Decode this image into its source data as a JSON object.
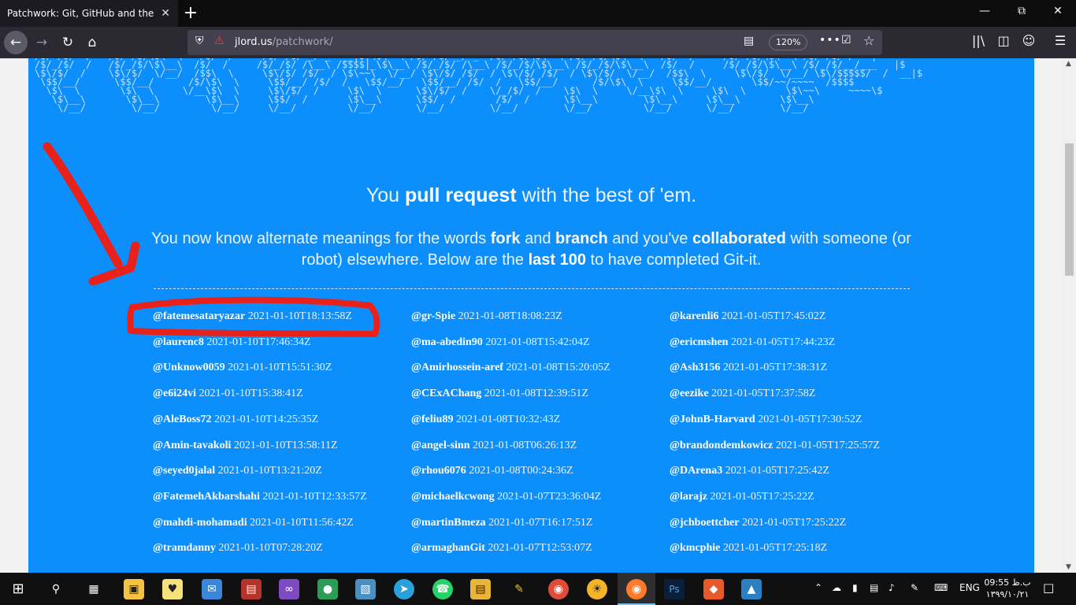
{
  "browser": {
    "tab_title": "Patchwork: Git, GitHub and the Pull",
    "tab_close": "✕",
    "new_tab": "+",
    "url_domain": "jlord.us",
    "url_path": "/patchwork/",
    "zoom": "120%"
  },
  "page": {
    "ascii_art": "/$/ /$/  /   /$/ /$/\\$\\  \\   /$/  /     /$/ /$/ _/ _  __|$|\\$\\  \\ /$/ /$/ _/ _  /$/ /$/\\$\\  \\ /$/ /$/\\$\\  \\   /$/  /     /$/ /$/\\$\\  \\ /$/ /$/ /   |\n/$/_/$/  /   /$/_/$/\\$\\__\\  /$/  /     /$/_/$/ /\\__\\ /$$$$|_\\$\\__\\ /$/_/$/ /\\__\\ /$/_/$/\\$\\__\\ /$/_/$/\\$\\__\\  /$/  /     /$/_/$/\\$\\__\\ /$/_/$/__/___   |$\n\\$\\/$/  /    \\$\\/$/  \\/__/  /$$\\  \\     \\$\\/$/ /$/  / \\$\\~~\\  \\/__/ \\$\\/$/ /$/  / \\$\\/$/ /$/  / \\$\\/$/  \\/__/  /$$\\  \\     \\$\\/$/  \\/__/ \\$\\/$$$$$/  /  __|$\n \\$$/__/      \\$$/__/      /$/\\$\\  \\     \\$$/__/ /$/  /   \\$$/__/   \\$$/__/ /$/  /   \\$$/__/      /$/\\$\\  \\     \\$$/__/       \\$$/~~/~~~~  /$$$$\n  \\$\\  \\       \\$\\  \\     \\/__\\$\\  \\     \\$\\/$/  /     \\$\\  \\      \\$\\/$/  /    \\/_/$/  /    \\$\\  \\     \\/__\\$\\  \\     \\$\\  \\       \\$\\~~\\     ~~~~\\$\n   \\$\\__\\       \\$\\__\\        \\$\\__\\     \\$$/  /       \\$\\__\\      \\$$/  /       /$/  /      \\$\\__\\        \\$\\__\\     \\$\\__\\       \\$\\__\\\n    \\/__/        \\/__/         \\/__/     \\/__/         \\/__/       \\/__/        \\/__/        \\/__/         \\/__/      \\/__/        \\/__/",
    "heading": {
      "pre": "You ",
      "bold": "pull request",
      "post": " with the best of 'em."
    },
    "intro": {
      "t1": "You now know alternate meanings for the words ",
      "b1": "fork",
      "t2": " and ",
      "b2": "branch",
      "t3": " and you've ",
      "b3": "collaborated",
      "t4": " with someone (or robot) elsewhere. Below are the ",
      "b4": "last 100",
      "t5": " to have completed Git-it."
    },
    "entries": [
      [
        {
          "user": "@fatemesataryazar",
          "time": "2021-01-10T18:13:58Z"
        },
        {
          "user": "@laurenc8",
          "time": "2021-01-10T17:46:34Z"
        },
        {
          "user": "@Unknow0059",
          "time": "2021-01-10T15:51:30Z"
        },
        {
          "user": "@e6i24vi",
          "time": "2021-01-10T15:38:41Z"
        },
        {
          "user": "@AleBoss72",
          "time": "2021-01-10T14:25:35Z"
        },
        {
          "user": "@Amin-tavakoli",
          "time": "2021-01-10T13:58:11Z"
        },
        {
          "user": "@seyed0jalal",
          "time": "2021-01-10T13:21:20Z"
        },
        {
          "user": "@FatemehAkbarshahi",
          "time": "2021-01-10T12:33:57Z"
        },
        {
          "user": "@mahdi-mohamadi",
          "time": "2021-01-10T11:56:42Z"
        },
        {
          "user": "@tramdanny",
          "time": "2021-01-10T07:28:20Z"
        }
      ],
      [
        {
          "user": "@gr-Spie",
          "time": "2021-01-08T18:08:23Z"
        },
        {
          "user": "@ma-abedin90",
          "time": "2021-01-08T15:42:04Z"
        },
        {
          "user": "@Amirhossein-aref",
          "time": "2021-01-08T15:20:05Z"
        },
        {
          "user": "@CExAChang",
          "time": "2021-01-08T12:39:51Z"
        },
        {
          "user": "@feliu89",
          "time": "2021-01-08T10:32:43Z"
        },
        {
          "user": "@angel-sinn",
          "time": "2021-01-08T06:26:13Z"
        },
        {
          "user": "@rhou6076",
          "time": "2021-01-08T00:24:36Z"
        },
        {
          "user": "@michaelkcwong",
          "time": "2021-01-07T23:36:04Z"
        },
        {
          "user": "@martinBmeza",
          "time": "2021-01-07T16:17:51Z"
        },
        {
          "user": "@armaghanGit",
          "time": "2021-01-07T12:53:07Z"
        }
      ],
      [
        {
          "user": "@karenli6",
          "time": "2021-01-05T17:45:02Z"
        },
        {
          "user": "@ericmshen",
          "time": "2021-01-05T17:44:23Z"
        },
        {
          "user": "@Ash3156",
          "time": "2021-01-05T17:38:31Z"
        },
        {
          "user": "@eezike",
          "time": "2021-01-05T17:37:58Z"
        },
        {
          "user": "@JohnB-Harvard",
          "time": "2021-01-05T17:30:52Z"
        },
        {
          "user": "@brandondemkowicz",
          "time": "2021-01-05T17:25:57Z"
        },
        {
          "user": "@DArena3",
          "time": "2021-01-05T17:25:42Z"
        },
        {
          "user": "@larajz",
          "time": "2021-01-05T17:25:22Z"
        },
        {
          "user": "@jchboettcher",
          "time": "2021-01-05T17:25:22Z"
        },
        {
          "user": "@kmcphie",
          "time": "2021-01-05T17:25:18Z"
        }
      ]
    ]
  },
  "taskbar": {
    "language": "ENG",
    "clock_time": "09:55 ب.ظ",
    "clock_date": "۱۳۹۹/۱۰/۲۱"
  },
  "colors": {
    "page_bg": "#0d8efd",
    "annotation": "#e8211a"
  },
  "icons": [
    "back-arrow",
    "forward-arrow",
    "reload",
    "home",
    "shield",
    "lock-broken",
    "reader-view",
    "more-dots",
    "pocket",
    "star",
    "library",
    "sidebar",
    "account",
    "menu",
    "windows-start",
    "search",
    "task-view"
  ]
}
